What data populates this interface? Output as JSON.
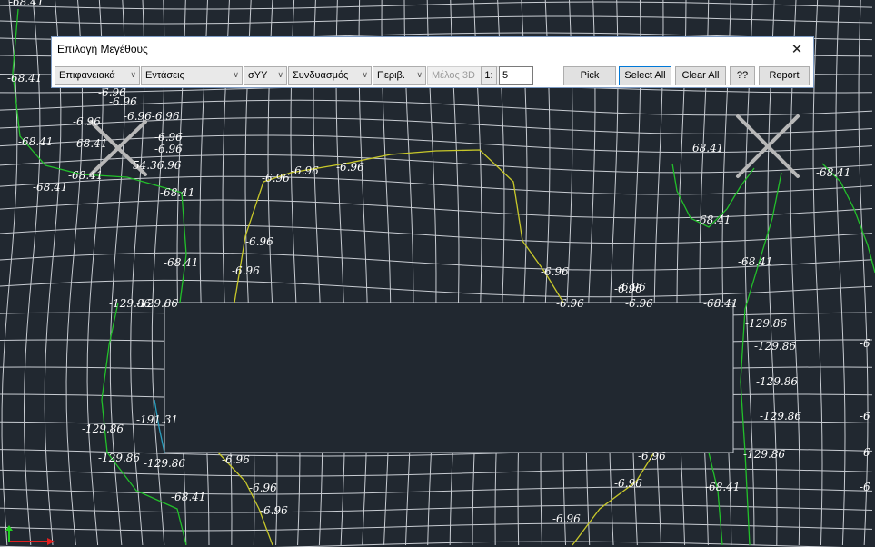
{
  "dialog": {
    "title": "Επιλογή Μεγέθους",
    "close_symbol": "✕",
    "combos": [
      {
        "name": "surface-combo",
        "value": "Επιφανειακά",
        "disabled": false
      },
      {
        "name": "forces-combo",
        "value": "Εντάσεις",
        "disabled": false
      },
      {
        "name": "stress-combo",
        "value": "σYY",
        "disabled": false
      },
      {
        "name": "combination-combo",
        "value": "Συνδυασμός",
        "disabled": false
      },
      {
        "name": "envelope-combo",
        "value": "Περιβ.",
        "disabled": false
      },
      {
        "name": "member3d-combo",
        "value": "Μέλος 3D",
        "disabled": true
      }
    ],
    "scale_prefix": "1:",
    "scale_value": "5",
    "buttons": {
      "pick": "Pick",
      "select_all": "Select All",
      "clear_all": "Clear All",
      "help": "??",
      "report": "Report"
    }
  },
  "colors": {
    "background": "#212830",
    "mesh": "#c8ccd2",
    "contour_green": "#22c02a",
    "contour_yellow": "#c8c82a",
    "axis_x": "#e02020",
    "axis_y": "#20d020"
  },
  "contour_labels": [
    {
      "text": "-68.41",
      "id": "lbl-1"
    },
    {
      "text": "-68.41",
      "id": "lbl-2"
    },
    {
      "text": "-6.96",
      "id": "lbl-3"
    },
    {
      "text": "-6.96",
      "id": "lbl-4"
    },
    {
      "text": "-6.96",
      "id": "lbl-5"
    },
    {
      "text": "-6.96-6.96",
      "id": "lbl-6"
    },
    {
      "text": "-68.41",
      "id": "lbl-7"
    },
    {
      "text": "-68.41",
      "id": "lbl-8"
    },
    {
      "text": "-6.96",
      "id": "lbl-9"
    },
    {
      "text": "-6.96",
      "id": "lbl-10"
    },
    {
      "text": "54.36.96",
      "id": "lbl-11"
    },
    {
      "text": "-68.41",
      "id": "lbl-12"
    },
    {
      "text": "-68.41",
      "id": "lbl-13"
    },
    {
      "text": "-68.41",
      "id": "lbl-14"
    },
    {
      "text": "-6.96",
      "id": "lbl-15"
    },
    {
      "text": "-6.96",
      "id": "lbl-16"
    },
    {
      "text": "-6.96",
      "id": "lbl-17"
    },
    {
      "text": "-6.96",
      "id": "lbl-18"
    },
    {
      "text": "-68.41",
      "id": "lbl-19"
    },
    {
      "text": "-6.96",
      "id": "lbl-20"
    },
    {
      "text": "-129.86",
      "id": "lbl-21"
    },
    {
      "text": "-129.86",
      "id": "lbl-22"
    },
    {
      "text": "-6.96",
      "id": "lbl-23"
    },
    {
      "text": "-6.96",
      "id": "lbl-24"
    },
    {
      "text": "-6.96",
      "id": "lbl-25"
    },
    {
      "text": "-6.96",
      "id": "lbl-26"
    },
    {
      "text": "-6.96",
      "id": "lbl-27"
    },
    {
      "text": "68.41",
      "id": "lbl-28"
    },
    {
      "text": "-68.41",
      "id": "lbl-29"
    },
    {
      "text": "-68.41",
      "id": "lbl-30"
    },
    {
      "text": "-68.41",
      "id": "lbl-31"
    },
    {
      "text": "-68.41",
      "id": "lbl-32"
    },
    {
      "text": "-129.86",
      "id": "lbl-33"
    },
    {
      "text": "-129.86",
      "id": "lbl-34"
    },
    {
      "text": "-129.86",
      "id": "lbl-35"
    },
    {
      "text": "-129.86",
      "id": "lbl-36"
    },
    {
      "text": "-129.86",
      "id": "lbl-37"
    },
    {
      "text": "-191.31",
      "id": "lbl-38"
    },
    {
      "text": "-129.86",
      "id": "lbl-39"
    },
    {
      "text": "-129.86",
      "id": "lbl-40"
    },
    {
      "text": "-129.86",
      "id": "lbl-41"
    },
    {
      "text": "-6.96",
      "id": "lbl-42"
    },
    {
      "text": "-68.41",
      "id": "lbl-43"
    },
    {
      "text": "-6.96",
      "id": "lbl-44"
    },
    {
      "text": "-6.96",
      "id": "lbl-45"
    },
    {
      "text": "-6.96",
      "id": "lbl-46"
    },
    {
      "text": "-6.96",
      "id": "lbl-47"
    },
    {
      "text": "-6.96",
      "id": "lbl-48"
    },
    {
      "text": "-68.41",
      "id": "lbl-49"
    },
    {
      "text": "-6",
      "id": "lbl-50"
    },
    {
      "text": "-6",
      "id": "lbl-51"
    },
    {
      "text": "-6",
      "id": "lbl-52"
    },
    {
      "text": "-6",
      "id": "lbl-53"
    }
  ]
}
